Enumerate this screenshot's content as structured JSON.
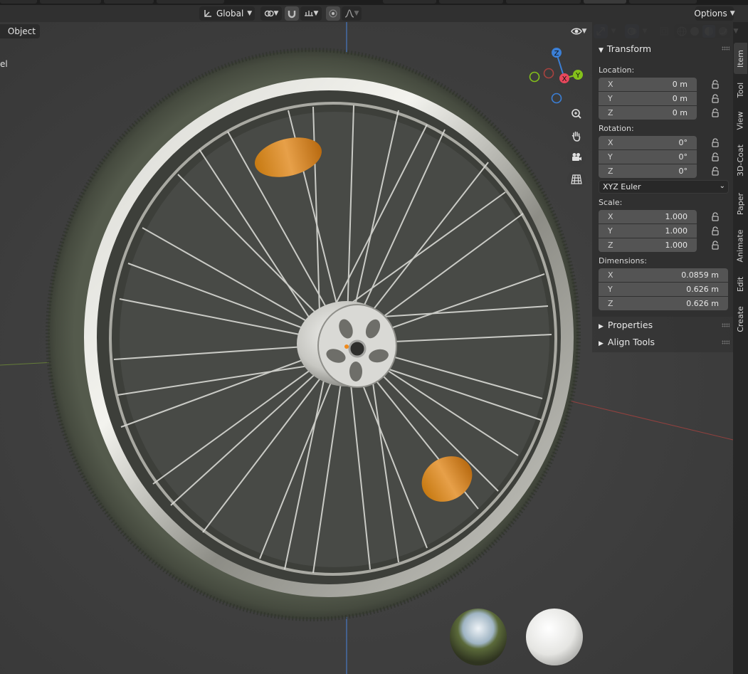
{
  "header": {
    "orientation_label": "Global",
    "options_label": "Options",
    "mode_button_label": "Object",
    "left_cut_label": "el"
  },
  "npanel": {
    "transform": {
      "title": "Transform",
      "location_label": "Location:",
      "location": [
        {
          "axis": "X",
          "value": "0 m"
        },
        {
          "axis": "Y",
          "value": "0 m"
        },
        {
          "axis": "Z",
          "value": "0 m"
        }
      ],
      "rotation_label": "Rotation:",
      "rotation": [
        {
          "axis": "X",
          "value": "0°"
        },
        {
          "axis": "Y",
          "value": "0°"
        },
        {
          "axis": "Z",
          "value": "0°"
        }
      ],
      "rotation_mode": "XYZ Euler",
      "scale_label": "Scale:",
      "scale": [
        {
          "axis": "X",
          "value": "1.000"
        },
        {
          "axis": "Y",
          "value": "1.000"
        },
        {
          "axis": "Z",
          "value": "1.000"
        }
      ],
      "dimensions_label": "Dimensions:",
      "dimensions": [
        {
          "axis": "X",
          "value": "0.0859 m"
        },
        {
          "axis": "Y",
          "value": "0.626 m"
        },
        {
          "axis": "Z",
          "value": "0.626 m"
        }
      ]
    },
    "properties_title": "Properties",
    "align_tools_title": "Align Tools"
  },
  "tabs": [
    "Item",
    "Tool",
    "View",
    "3D-Coat",
    "Paper",
    "Animate",
    "Edit",
    "Create"
  ],
  "gizmo": {
    "x": "X",
    "y": "Y",
    "z": "Z"
  },
  "colors": {
    "accent": "#4772b3",
    "axis_x": "#e8475c",
    "axis_y": "#84c11b",
    "axis_z": "#3b7fd6",
    "panel": "#303030"
  }
}
